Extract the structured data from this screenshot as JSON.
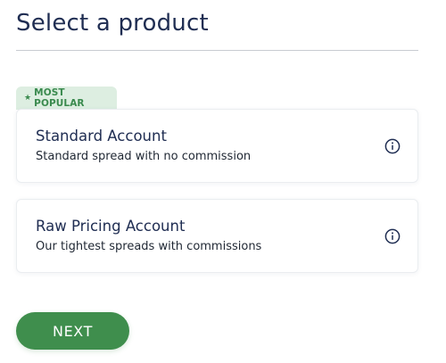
{
  "page": {
    "title": "Select a product"
  },
  "badge": {
    "icon": "star-icon",
    "label": "MOST POPULAR",
    "color": "#3a8a4e",
    "background": "#ddeee1"
  },
  "products": [
    {
      "name": "Standard Account",
      "description": "Standard spread with no commission",
      "icon": "info-icon"
    },
    {
      "name": "Raw Pricing Account",
      "description": "Our tightest spreads with commissions",
      "icon": "info-icon"
    }
  ],
  "actions": {
    "next_label": "NEXT"
  },
  "colors": {
    "primary_text": "#1f2d52",
    "accent_green": "#3f8e4d"
  }
}
